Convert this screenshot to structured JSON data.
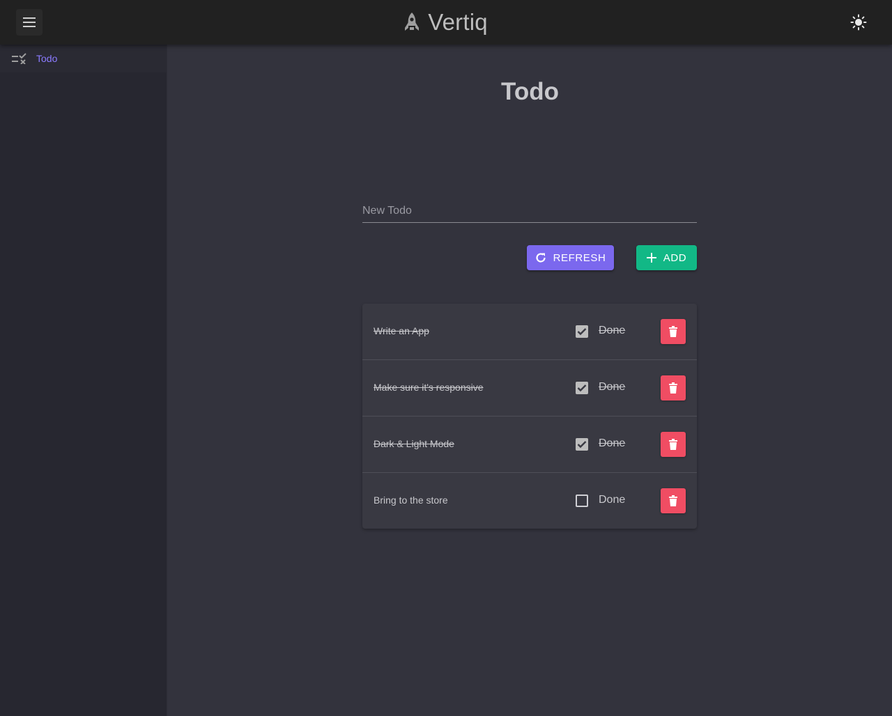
{
  "app": {
    "title": "Vertiq",
    "brand_icon": "rocket-icon"
  },
  "header": {
    "menu_icon": "hamburger-menu-icon",
    "theme_icon": "sun-icon"
  },
  "sidebar": {
    "items": [
      {
        "label": "Todo",
        "icon": "checklist-icon",
        "active": true
      }
    ]
  },
  "main": {
    "title": "Todo",
    "input": {
      "placeholder": "New Todo",
      "value": ""
    },
    "buttons": {
      "refresh_label": "REFRESH",
      "add_label": "ADD"
    },
    "todos": [
      {
        "text": "Write an App",
        "done": true,
        "done_label": "Done"
      },
      {
        "text": "Make sure it's responsive",
        "done": true,
        "done_label": "Done"
      },
      {
        "text": "Dark & Light Mode",
        "done": true,
        "done_label": "Done"
      },
      {
        "text": "Bring to the store",
        "done": false,
        "done_label": "Done"
      }
    ]
  },
  "colors": {
    "accent": "#7b68ee",
    "success": "#12b886",
    "danger": "#f04d63",
    "topbar": "#212121",
    "background": "#33333d"
  }
}
